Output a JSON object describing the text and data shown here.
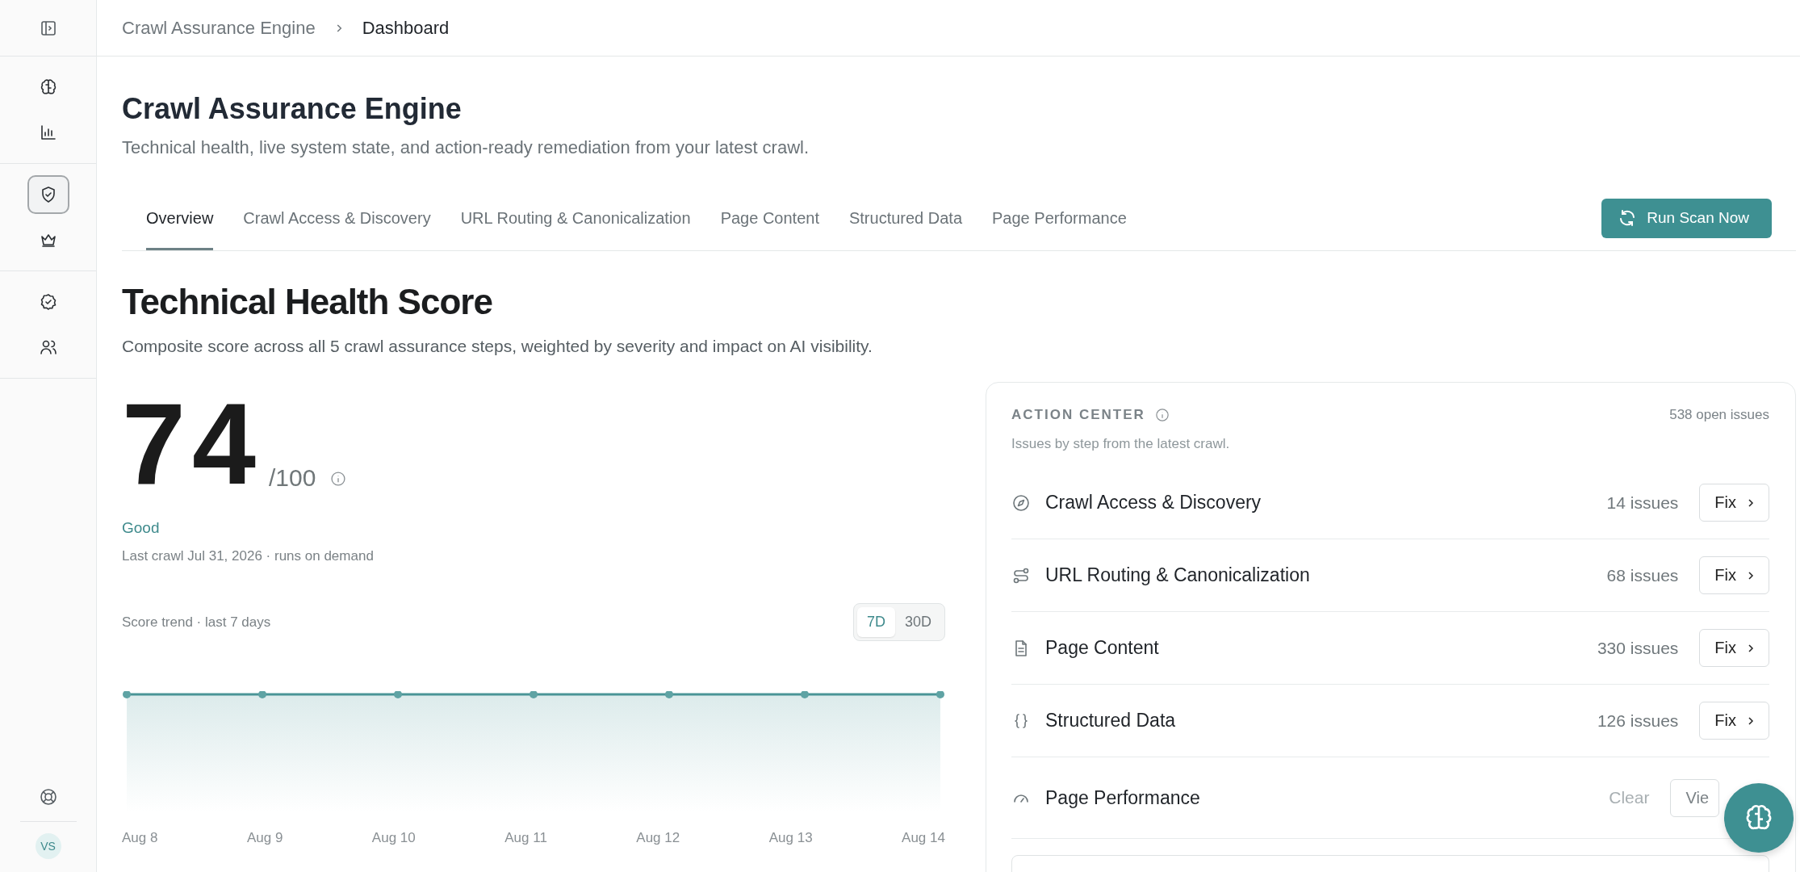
{
  "sidebar": {
    "groups": [
      [
        {
          "selected": false
        },
        {
          "selected": false
        }
      ],
      [
        {
          "selected": true
        },
        {
          "selected": false
        }
      ],
      [
        {
          "selected": false
        },
        {
          "selected": false
        }
      ]
    ],
    "avatar": "VS"
  },
  "breadcrumb": [
    "Crawl Assurance Engine",
    "Dashboard"
  ],
  "header": {
    "title": "Crawl Assurance Engine",
    "subtitle": "Technical health, live system state, and action-ready remediation from your latest crawl."
  },
  "tabs": [
    {
      "label": "Overview",
      "selected": true
    },
    {
      "label": "Crawl Access & Discovery",
      "selected": false
    },
    {
      "label": "URL Routing & Canonicalization",
      "selected": false
    },
    {
      "label": "Page Content",
      "selected": false
    },
    {
      "label": "Structured Data",
      "selected": false
    },
    {
      "label": "Page Performance",
      "selected": false
    }
  ],
  "run_button": "Run Scan Now",
  "health": {
    "title": "Technical Health Score",
    "description": "Composite score across all 5 crawl assurance steps, weighted by severity and impact on AI visibility.",
    "score": "74",
    "max": "/100",
    "rating": "Good",
    "last_crawl": "Last crawl Jul 31, 2026 · runs on demand"
  },
  "trend": {
    "label": "Score trend · last 7 days",
    "ranges": [
      {
        "label": "7D",
        "selected": true
      },
      {
        "label": "30D",
        "selected": false
      }
    ],
    "x_labels": [
      "Aug 8",
      "Aug 9",
      "Aug 10",
      "Aug 11",
      "Aug 12",
      "Aug 13",
      "Aug 14"
    ]
  },
  "action_center": {
    "title": "ACTION CENTER",
    "open_issues": "538 open issues",
    "subtitle": "Issues by step from the latest crawl.",
    "rows": [
      {
        "name": "Crawl Access & Discovery",
        "kind": "issues",
        "status": "14 issues",
        "action": "Fix"
      },
      {
        "name": "URL Routing & Canonicalization",
        "kind": "issues",
        "status": "68 issues",
        "action": "Fix"
      },
      {
        "name": "Page Content",
        "kind": "issues",
        "status": "330 issues",
        "action": "Fix"
      },
      {
        "name": "Structured Data",
        "kind": "issues",
        "status": "126 issues",
        "action": "Fix"
      },
      {
        "name": "Page Performance",
        "kind": "clear",
        "status": "Clear",
        "action": "Vie"
      }
    ]
  }
}
